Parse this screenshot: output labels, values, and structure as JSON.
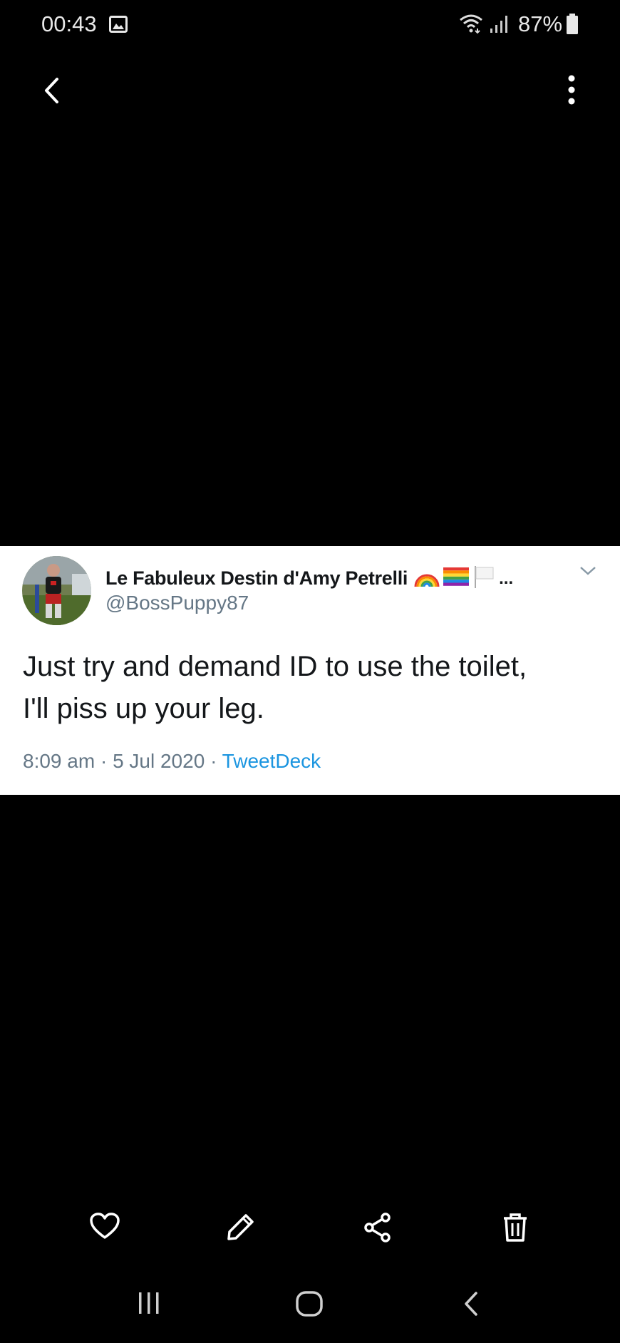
{
  "status_bar": {
    "time": "00:43",
    "battery_percent": "87%"
  },
  "tweet": {
    "display_name": "Le Fabuleux Destin d'Amy Petrelli",
    "name_truncation": "...",
    "handle": "@BossPuppy87",
    "text_line1": "Just try and demand ID to use the toilet,",
    "text_line2": "I'll piss up your leg.",
    "time": "8:09 am",
    "separator": "·",
    "date": "5 Jul 2020",
    "source": "TweetDeck"
  },
  "icons": {
    "status": [
      "gallery-icon",
      "wifi-icon",
      "signal-icon",
      "battery-icon"
    ],
    "top": [
      "back-icon",
      "more-icon"
    ],
    "actions": [
      "heart-icon",
      "edit-icon",
      "share-icon",
      "delete-icon"
    ],
    "nav": [
      "recent-apps-icon",
      "home-icon",
      "nav-back-icon"
    ]
  },
  "colors": {
    "background": "#000000",
    "tweet_card": "#ffffff",
    "handle_gray": "#657786",
    "link_blue": "#1b95e0"
  }
}
